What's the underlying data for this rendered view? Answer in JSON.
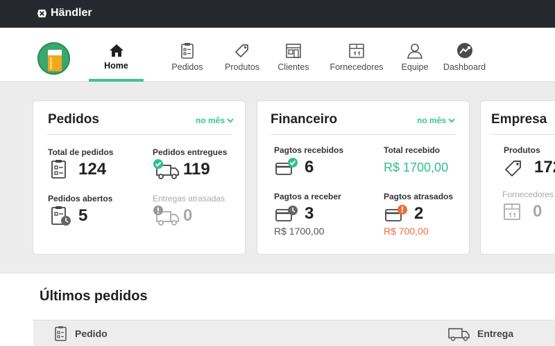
{
  "brand": {
    "name": "Händler",
    "icon": "handler-logo-icon"
  },
  "user": {
    "avatar": "beer-avatar"
  },
  "nav": {
    "items": [
      {
        "label": "Home",
        "icon": "home-icon",
        "active": true
      },
      {
        "label": "Pedidos",
        "icon": "clipboard-icon"
      },
      {
        "label": "Produtos",
        "icon": "tag-icon"
      },
      {
        "label": "Clientes",
        "icon": "storefront-icon"
      },
      {
        "label": "Fornecedores",
        "icon": "box-icon"
      },
      {
        "label": "Equipe",
        "icon": "person-icon"
      },
      {
        "label": "Dashboard",
        "icon": "chart-icon"
      }
    ]
  },
  "cards": {
    "pedidos": {
      "title": "Pedidos",
      "filter": "no mês",
      "stats": [
        {
          "label": "Total de pedidos",
          "value": "124",
          "icon": "clipboard-icon"
        },
        {
          "label": "Pedidos entregues",
          "value": "119",
          "icon": "truck-check-icon"
        },
        {
          "label": "Pedidos abertos",
          "value": "5",
          "icon": "clipboard-clock-icon"
        },
        {
          "label": "Entregas atrasadas",
          "value": "0",
          "icon": "truck-alert-icon"
        }
      ]
    },
    "financeiro": {
      "title": "Financeiro",
      "filter": "no mês",
      "stats": [
        {
          "label": "Pagtos recebidos",
          "value": "6",
          "icon": "card-check-icon"
        },
        {
          "label": "Total recebido",
          "value": "R$ 1700,00"
        },
        {
          "label": "Pagtos a receber",
          "value": "3",
          "sub": "R$ 1700,00",
          "icon": "card-clock-icon"
        },
        {
          "label": "Pagtos atrasados",
          "value": "2",
          "sub": "R$ 700,00",
          "icon": "card-alert-icon"
        }
      ]
    },
    "empresa": {
      "title": "Empresa",
      "stats": [
        {
          "label": "Produtos",
          "value": "172",
          "icon": "tag-icon"
        },
        {
          "label": "Fornecedores",
          "value": "0",
          "icon": "box-icon"
        }
      ]
    }
  },
  "recent": {
    "title": "Últimos pedidos",
    "columns": [
      {
        "label": "Pedido",
        "icon": "clipboard-icon"
      },
      {
        "label": "Entrega",
        "icon": "truck-icon"
      }
    ]
  },
  "colors": {
    "accent": "#3cc39a",
    "topbar": "#25282c",
    "alert": "#f26a3a"
  }
}
